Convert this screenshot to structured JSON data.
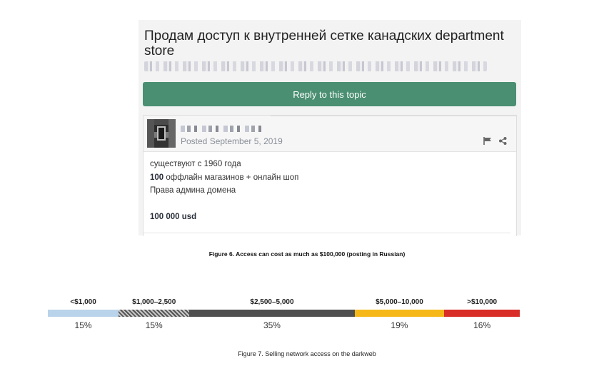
{
  "post_screenshot": {
    "title": "Продам доступ к внутренней сетке канадских department store",
    "reply_button": "Reply to this topic",
    "posted_text": "Posted September 5, 2019",
    "body": {
      "line1": "существуют с 1960 года",
      "line2_bold": "100",
      "line2_rest": " оффлайн магазинов  + онлайн шоп",
      "line3": "Права админа домена",
      "price": "100 000 usd"
    }
  },
  "figure6_caption": "Figure 6. Access can cost as much as $100,000 (posting in Russian)",
  "price_distribution": {
    "segments": [
      {
        "label": "<$1,000",
        "percent": "15%",
        "color": "#b9d3ea",
        "pattern": "solid"
      },
      {
        "label": "$1,000–2,500",
        "percent": "15%",
        "color": "#555555",
        "pattern": "hatched"
      },
      {
        "label": "$2,500–5,000",
        "percent": "35%",
        "color": "#4f4f4f",
        "pattern": "solid"
      },
      {
        "label": "$5,000–10,000",
        "percent": "19%",
        "color": "#f5b818",
        "pattern": "solid"
      },
      {
        "label": ">$10,000",
        "percent": "16%",
        "color": "#d92d27",
        "pattern": "solid"
      }
    ]
  },
  "figure7_caption": "Figure 7. Selling network access on the darkweb"
}
